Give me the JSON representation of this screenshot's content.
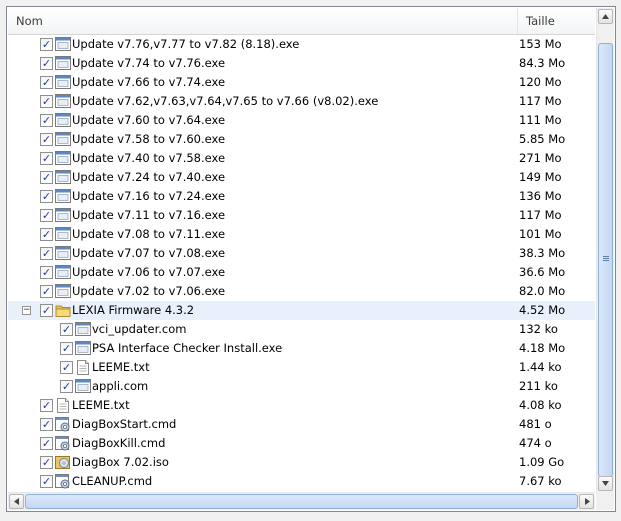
{
  "columns": {
    "name": "Nom",
    "size": "Taille"
  },
  "items": [
    {
      "name": "Update v7.76,v7.77 to v7.82 (8.18).exe",
      "size": "153 Mo",
      "icon": "exe-icon",
      "level": 1,
      "checked": true
    },
    {
      "name": "Update v7.74 to v7.76.exe",
      "size": "84.3 Mo",
      "icon": "exe-icon",
      "level": 1,
      "checked": true
    },
    {
      "name": "Update v7.66 to v7.74.exe",
      "size": "120 Mo",
      "icon": "exe-icon",
      "level": 1,
      "checked": true
    },
    {
      "name": "Update v7.62,v7.63,v7.64,v7.65 to v7.66 (v8.02).exe",
      "size": "117 Mo",
      "icon": "exe-icon",
      "level": 1,
      "checked": true
    },
    {
      "name": "Update v7.60 to v7.64.exe",
      "size": "111 Mo",
      "icon": "exe-icon",
      "level": 1,
      "checked": true
    },
    {
      "name": "Update v7.58 to v7.60.exe",
      "size": "5.85 Mo",
      "icon": "exe-icon",
      "level": 1,
      "checked": true
    },
    {
      "name": "Update v7.40 to v7.58.exe",
      "size": "271 Mo",
      "icon": "exe-icon",
      "level": 1,
      "checked": true
    },
    {
      "name": "Update v7.24 to v7.40.exe",
      "size": "149 Mo",
      "icon": "exe-icon",
      "level": 1,
      "checked": true
    },
    {
      "name": "Update v7.16 to v7.24.exe",
      "size": "136 Mo",
      "icon": "exe-icon",
      "level": 1,
      "checked": true
    },
    {
      "name": "Update v7.11 to v7.16.exe",
      "size": "117 Mo",
      "icon": "exe-icon",
      "level": 1,
      "checked": true
    },
    {
      "name": "Update v7.08 to v7.11.exe",
      "size": "101 Mo",
      "icon": "exe-icon",
      "level": 1,
      "checked": true
    },
    {
      "name": "Update v7.07 to v7.08.exe",
      "size": "38.3 Mo",
      "icon": "exe-icon",
      "level": 1,
      "checked": true
    },
    {
      "name": "Update v7.06 to v7.07.exe",
      "size": "36.6 Mo",
      "icon": "exe-icon",
      "level": 1,
      "checked": true
    },
    {
      "name": "Update v7.02 to v7.06.exe",
      "size": "82.0 Mo",
      "icon": "exe-icon",
      "level": 1,
      "checked": true
    },
    {
      "name": "LEXIA Firmware 4.3.2",
      "size": "4.52 Mo",
      "icon": "folder-icon",
      "level": 1,
      "checked": true,
      "expander": "−",
      "selected": true
    },
    {
      "name": "vci_updater.com",
      "size": "132 ko",
      "icon": "exe-icon",
      "level": 2,
      "checked": true
    },
    {
      "name": "PSA Interface Checker Install.exe",
      "size": "4.18 Mo",
      "icon": "exe-icon",
      "level": 2,
      "checked": true
    },
    {
      "name": "LEEME.txt",
      "size": "1.44 ko",
      "icon": "text-file-icon",
      "level": 2,
      "checked": true
    },
    {
      "name": "appli.com",
      "size": "211 ko",
      "icon": "exe-icon",
      "level": 2,
      "checked": true
    },
    {
      "name": "LEEME.txt",
      "size": "4.08 ko",
      "icon": "text-file-icon",
      "level": 1,
      "checked": true
    },
    {
      "name": "DiagBoxStart.cmd",
      "size": "481 o",
      "icon": "cmd-script-icon",
      "level": 1,
      "checked": true
    },
    {
      "name": "DiagBoxKill.cmd",
      "size": "474 o",
      "icon": "cmd-script-icon",
      "level": 1,
      "checked": true
    },
    {
      "name": "DiagBox 7.02.iso",
      "size": "1.09 Go",
      "icon": "disc-image-icon",
      "level": 1,
      "checked": true
    },
    {
      "name": "CLEANUP.cmd",
      "size": "7.67 ko",
      "icon": "cmd-script-icon",
      "level": 1,
      "checked": true
    }
  ],
  "check_mark": "✓",
  "colors": {
    "selected_row": "#e8f1fb",
    "checkmark": "#1f3a93",
    "scroll_thumb": "#c4d8f2"
  }
}
